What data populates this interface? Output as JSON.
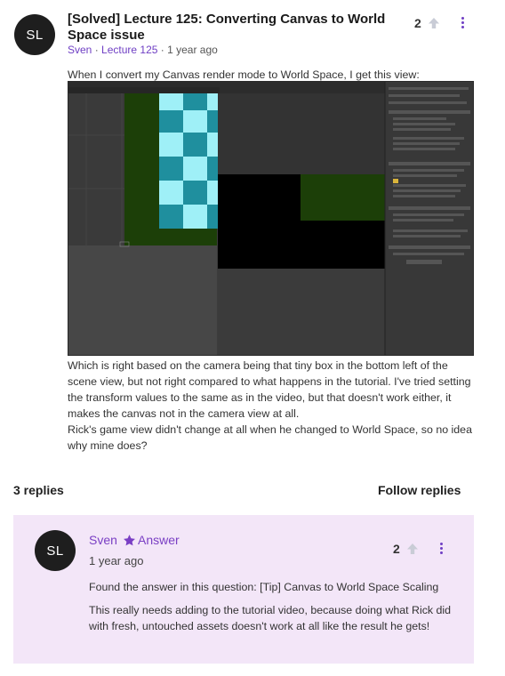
{
  "post": {
    "avatar_initials": "SL",
    "title": "[Solved] Lecture 125: Converting Canvas to World Space issue",
    "author": "Sven",
    "separator": " · ",
    "lecture": "Lecture 125",
    "time": " · 1 year ago",
    "votes": "2",
    "paragraph_1": "When I convert my Canvas render mode to World Space, I get this view:",
    "paragraph_2": "Which is right based on the camera being that tiny box in the bottom left of the scene view, but not right compared to what happens in the tutorial. I've tried setting the transform values to the same as in the video, but that doesn't work either, it makes the canvas not in the camera view at all.",
    "paragraph_3": "Rick's game view didn't change at all when he changed to World Space, so no idea why mine does?"
  },
  "replies": {
    "count_label": "3 replies",
    "follow_label": "Follow replies"
  },
  "reply": {
    "avatar_initials": "SL",
    "author": "Sven",
    "badge": "Answer",
    "time": "1 year ago",
    "votes": "2",
    "paragraph_1": "Found the answer in this question: [Tip] Canvas to World Space Scaling",
    "paragraph_2": "This really needs adding to the tutorial video, because doing what Rick did with fresh, untouched assets doesn't work at all like the result he gets!"
  },
  "icons": {
    "upvote": "arrow-up-icon",
    "menu": "kebab-menu-icon",
    "answer": "star-icon"
  },
  "colors": {
    "accent": "#6f3fc4",
    "reply_bg": "#f3e6f8",
    "avatar_bg": "#1e1e1e"
  }
}
